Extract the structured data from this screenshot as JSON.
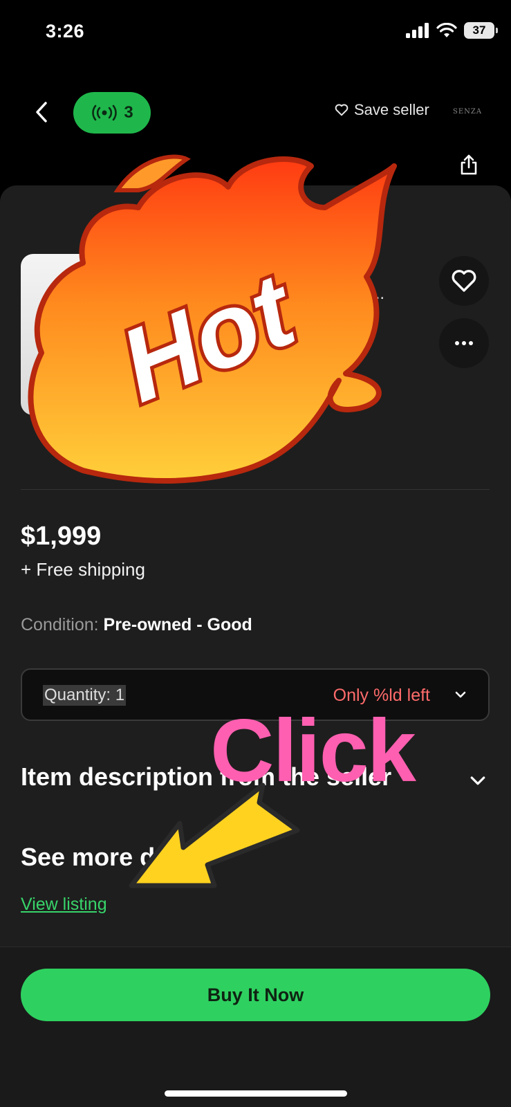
{
  "status_bar": {
    "time": "3:26",
    "battery": "37"
  },
  "nav": {
    "live_count": "3",
    "save_seller": "Save seller",
    "brand": "SENZA"
  },
  "item": {
    "title_fragment_line1": "n",
    "title_fragment_line2": "ogra...",
    "price": "$1,999",
    "shipping": "+ Free shipping",
    "condition_label": "Condition:",
    "condition_value": "Pre-owned - Good"
  },
  "quantity": {
    "label": "Quantity: 1",
    "stock_note": "Only %ld left"
  },
  "description": {
    "title": "Item description from the seller"
  },
  "more": {
    "title": "See more d",
    "link": "View listing"
  },
  "actions": {
    "buy_now": "Buy It Now"
  },
  "stickers": {
    "hot": "Hot",
    "click": "Click"
  },
  "colors": {
    "accent_green": "#2ed160",
    "live_green": "#1fb74b",
    "stock_warning": "#ff6b6b",
    "click_pink": "#ff5fb0"
  }
}
